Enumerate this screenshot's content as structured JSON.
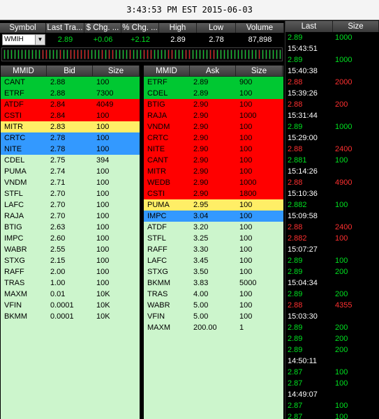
{
  "header": {
    "clock": "3:43:53 PM EST 2015-06-03"
  },
  "quote": {
    "columns": [
      "Symbol",
      "Last Tra...",
      "$ Chg. ...",
      "% Chg. ...",
      "High",
      "Low",
      "Volume"
    ],
    "symbol": "WMIH",
    "last": "2.89",
    "chg": "+0.06",
    "pct": "+2.12",
    "high": "2.89",
    "low": "2.78",
    "volume": "87,898"
  },
  "tick_colors": [
    "green",
    "green",
    "green",
    "green",
    "green",
    "green",
    "green",
    "green",
    "green",
    "green",
    "green",
    "red",
    "red",
    "green",
    "green",
    "green",
    "red",
    "green",
    "green",
    "red",
    "red",
    "red",
    "red",
    "red",
    "red",
    "green",
    "green",
    "green",
    "red",
    "green",
    "red",
    "red",
    "green",
    "green",
    "green",
    "green",
    "red",
    "green",
    "green",
    "green",
    "red",
    "red",
    "red",
    "green",
    "green",
    "green",
    "green",
    "red",
    "red",
    "green",
    "green",
    "green",
    "red",
    "red",
    "green",
    "green",
    "green",
    "green",
    "green",
    "red",
    "red",
    "green",
    "green",
    "green",
    "green",
    "green",
    "green",
    "green",
    "green",
    "green",
    "green",
    "green",
    "green",
    "red",
    "green",
    "green",
    "green",
    "green",
    "green",
    "green",
    "green",
    "red",
    "red",
    "red",
    "red",
    "green",
    "green",
    "green",
    "green",
    "red",
    "green",
    "green",
    "green",
    "green",
    "green",
    "green",
    "green",
    "red",
    "red",
    "red",
    "green",
    "green",
    "green",
    "green",
    "green",
    "green",
    "red",
    "red",
    "green",
    "green",
    "green",
    "green",
    "red"
  ],
  "bid": {
    "headers": [
      "MMID",
      "Bid",
      "Size"
    ],
    "rows": [
      {
        "mmid": "CANT",
        "price": "2.88",
        "size": "100",
        "color": "#00c832"
      },
      {
        "mmid": "ETRF",
        "price": "2.88",
        "size": "7300",
        "color": "#00c832"
      },
      {
        "mmid": "ATDF",
        "price": "2.84",
        "size": "4049",
        "color": "#ff0000"
      },
      {
        "mmid": "CSTI",
        "price": "2.84",
        "size": "100",
        "color": "#ff0000"
      },
      {
        "mmid": "MITR",
        "price": "2.83",
        "size": "100",
        "color": "#ffee66"
      },
      {
        "mmid": "CRTC",
        "price": "2.78",
        "size": "100",
        "color": "#3399ff"
      },
      {
        "mmid": "NITE",
        "price": "2.78",
        "size": "100",
        "color": "#3399ff"
      },
      {
        "mmid": "CDEL",
        "price": "2.75",
        "size": "394",
        "color": "#ccf5cc"
      },
      {
        "mmid": "PUMA",
        "price": "2.74",
        "size": "100",
        "color": "#ccf5cc"
      },
      {
        "mmid": "VNDM",
        "price": "2.71",
        "size": "100",
        "color": "#ccf5cc"
      },
      {
        "mmid": "STFL",
        "price": "2.70",
        "size": "100",
        "color": "#ccf5cc"
      },
      {
        "mmid": "LAFC",
        "price": "2.70",
        "size": "100",
        "color": "#ccf5cc"
      },
      {
        "mmid": "RAJA",
        "price": "2.70",
        "size": "100",
        "color": "#ccf5cc"
      },
      {
        "mmid": "BTIG",
        "price": "2.63",
        "size": "100",
        "color": "#ccf5cc"
      },
      {
        "mmid": "IMPC",
        "price": "2.60",
        "size": "100",
        "color": "#ccf5cc"
      },
      {
        "mmid": "WABR",
        "price": "2.55",
        "size": "100",
        "color": "#ccf5cc"
      },
      {
        "mmid": "STXG",
        "price": "2.15",
        "size": "100",
        "color": "#ccf5cc"
      },
      {
        "mmid": "RAFF",
        "price": "2.00",
        "size": "100",
        "color": "#ccf5cc"
      },
      {
        "mmid": "TRAS",
        "price": "1.00",
        "size": "100",
        "color": "#ccf5cc"
      },
      {
        "mmid": "MAXM",
        "price": "0.01",
        "size": "10K",
        "color": "#ccf5cc"
      },
      {
        "mmid": "VFIN",
        "price": "0.0001",
        "size": "10K",
        "color": "#ccf5cc"
      },
      {
        "mmid": "BKMM",
        "price": "0.0001",
        "size": "10K",
        "color": "#ccf5cc"
      }
    ]
  },
  "ask": {
    "headers": [
      "MMID",
      "Ask",
      "Size"
    ],
    "rows": [
      {
        "mmid": "ETRF",
        "price": "2.89",
        "size": "900",
        "color": "#00c832"
      },
      {
        "mmid": "CDEL",
        "price": "2.89",
        "size": "100",
        "color": "#00c832"
      },
      {
        "mmid": "BTIG",
        "price": "2.90",
        "size": "100",
        "color": "#ff0000"
      },
      {
        "mmid": "RAJA",
        "price": "2.90",
        "size": "1000",
        "color": "#ff0000"
      },
      {
        "mmid": "VNDM",
        "price": "2.90",
        "size": "100",
        "color": "#ff0000"
      },
      {
        "mmid": "CRTC",
        "price": "2.90",
        "size": "100",
        "color": "#ff0000"
      },
      {
        "mmid": "NITE",
        "price": "2.90",
        "size": "100",
        "color": "#ff0000"
      },
      {
        "mmid": "CANT",
        "price": "2.90",
        "size": "100",
        "color": "#ff0000"
      },
      {
        "mmid": "MITR",
        "price": "2.90",
        "size": "100",
        "color": "#ff0000"
      },
      {
        "mmid": "WEDB",
        "price": "2.90",
        "size": "1000",
        "color": "#ff0000"
      },
      {
        "mmid": "CSTI",
        "price": "2.90",
        "size": "1800",
        "color": "#ff0000"
      },
      {
        "mmid": "PUMA",
        "price": "2.95",
        "size": "100",
        "color": "#ffee66"
      },
      {
        "mmid": "IMPC",
        "price": "3.04",
        "size": "100",
        "color": "#3399ff"
      },
      {
        "mmid": "ATDF",
        "price": "3.20",
        "size": "100",
        "color": "#ccf5cc"
      },
      {
        "mmid": "STFL",
        "price": "3.25",
        "size": "100",
        "color": "#ccf5cc"
      },
      {
        "mmid": "RAFF",
        "price": "3.30",
        "size": "100",
        "color": "#ccf5cc"
      },
      {
        "mmid": "LAFC",
        "price": "3.45",
        "size": "100",
        "color": "#ccf5cc"
      },
      {
        "mmid": "STXG",
        "price": "3.50",
        "size": "100",
        "color": "#ccf5cc"
      },
      {
        "mmid": "BKMM",
        "price": "3.83",
        "size": "5000",
        "color": "#ccf5cc"
      },
      {
        "mmid": "TRAS",
        "price": "4.00",
        "size": "100",
        "color": "#ccf5cc"
      },
      {
        "mmid": "WABR",
        "price": "5.00",
        "size": "100",
        "color": "#ccf5cc"
      },
      {
        "mmid": "VFIN",
        "price": "5.00",
        "size": "100",
        "color": "#ccf5cc"
      },
      {
        "mmid": "MAXM",
        "price": "200.00",
        "size": "1",
        "color": "#ccf5cc"
      }
    ]
  },
  "tape": {
    "headers": [
      "Last",
      "Size"
    ],
    "entries": [
      {
        "type": "trade",
        "price": "2.89",
        "size": "1000",
        "color": "#00e020"
      },
      {
        "type": "time",
        "text": "15:43:51"
      },
      {
        "type": "trade",
        "price": "2.89",
        "size": "1000",
        "color": "#00e020"
      },
      {
        "type": "time",
        "text": "15:40:38"
      },
      {
        "type": "trade",
        "price": "2.88",
        "size": "2000",
        "color": "#ff3030"
      },
      {
        "type": "time",
        "text": "15:39:26"
      },
      {
        "type": "trade",
        "price": "2.88",
        "size": "200",
        "color": "#ff3030"
      },
      {
        "type": "time",
        "text": "15:31:44"
      },
      {
        "type": "trade",
        "price": "2.89",
        "size": "1000",
        "color": "#00e020"
      },
      {
        "type": "time",
        "text": "15:29:00"
      },
      {
        "type": "trade",
        "price": "2.88",
        "size": "2400",
        "color": "#ff3030"
      },
      {
        "type": "trade",
        "price": "2.881",
        "size": "100",
        "color": "#00e020"
      },
      {
        "type": "time",
        "text": "15:14:26"
      },
      {
        "type": "trade",
        "price": "2.88",
        "size": "4900",
        "color": "#ff3030"
      },
      {
        "type": "time",
        "text": "15:10:36"
      },
      {
        "type": "trade",
        "price": "2.882",
        "size": "100",
        "color": "#00e020"
      },
      {
        "type": "time",
        "text": "15:09:58"
      },
      {
        "type": "trade",
        "price": "2.88",
        "size": "2400",
        "color": "#ff3030"
      },
      {
        "type": "trade",
        "price": "2.882",
        "size": "100",
        "color": "#ff3030"
      },
      {
        "type": "time",
        "text": "15:07:27"
      },
      {
        "type": "trade",
        "price": "2.89",
        "size": "100",
        "color": "#00e020"
      },
      {
        "type": "trade",
        "price": "2.89",
        "size": "200",
        "color": "#00e020"
      },
      {
        "type": "time",
        "text": "15:04:34"
      },
      {
        "type": "trade",
        "price": "2.89",
        "size": "200",
        "color": "#00e020"
      },
      {
        "type": "trade",
        "price": "2.88",
        "size": "4355",
        "color": "#ff3030"
      },
      {
        "type": "time",
        "text": "15:03:30"
      },
      {
        "type": "trade",
        "price": "2.89",
        "size": "200",
        "color": "#00e020"
      },
      {
        "type": "trade",
        "price": "2.89",
        "size": "200",
        "color": "#00e020"
      },
      {
        "type": "trade",
        "price": "2.89",
        "size": "200",
        "color": "#00e020"
      },
      {
        "type": "time",
        "text": "14:50:11"
      },
      {
        "type": "trade",
        "price": "2.87",
        "size": "100",
        "color": "#00e020"
      },
      {
        "type": "trade",
        "price": "2.87",
        "size": "100",
        "color": "#00e020"
      },
      {
        "type": "time",
        "text": "14:49:07"
      },
      {
        "type": "trade",
        "price": "2.87",
        "size": "100",
        "color": "#00e020"
      },
      {
        "type": "trade",
        "price": "2.87",
        "size": "100",
        "color": "#00e020"
      }
    ]
  }
}
